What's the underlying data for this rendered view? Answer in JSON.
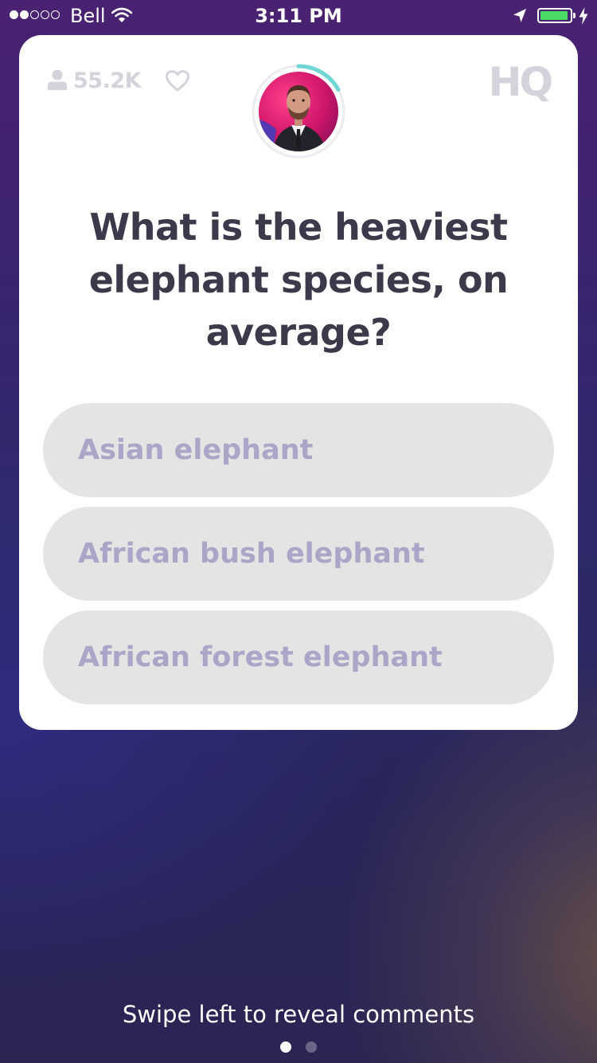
{
  "status_bar": {
    "signal_strength": 2,
    "signal_total": 5,
    "carrier": "Bell",
    "time": "3:11 PM",
    "battery_level": 0.95,
    "battery_color": "#4cd964",
    "icons": [
      "wifi-icon",
      "location-arrow-icon",
      "battery-icon",
      "charging-bolt-icon"
    ]
  },
  "game": {
    "viewer_count": "55.2K",
    "logo": "HQ",
    "timer_progress": 0.17,
    "timer_color": "#6fd6d3",
    "question": "What is the heaviest elephant species, on average?",
    "answers": [
      "Asian elephant",
      "African bush elephant",
      "African forest elephant"
    ]
  },
  "footer": {
    "hint": "Swipe left to reveal comments",
    "page_count": 2,
    "active_page": 1
  },
  "colors": {
    "card_background": "#ffffff",
    "answer_background": "#e4e4e4",
    "answer_text": "#a9a6c8",
    "question_text": "#3a3a4a",
    "muted_icon": "#d3d3dc"
  }
}
